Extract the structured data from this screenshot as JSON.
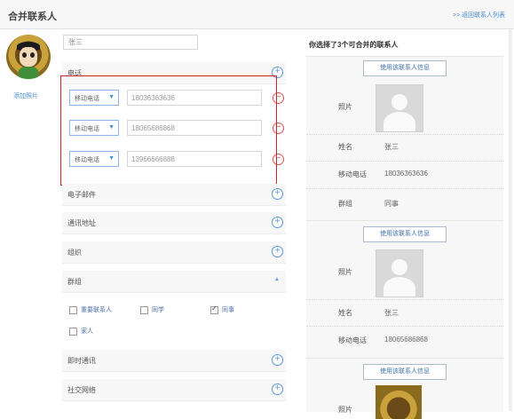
{
  "header": {
    "title": "合并联系人",
    "back_link": ">> 返回联系人列表"
  },
  "left": {
    "add_photo": "添加照片",
    "name_value": "张三",
    "sections": {
      "phone": "电话",
      "email": "电子邮件",
      "address": "通讯地址",
      "org": "组织",
      "group": "群组",
      "im": "即时通讯",
      "social": "社交网络"
    },
    "phones": [
      {
        "type": "移动电话",
        "number": "18036363636"
      },
      {
        "type": "移动电话",
        "number": "18065686868"
      },
      {
        "type": "移动电话",
        "number": "13966666888"
      }
    ],
    "groups": [
      {
        "label": "重要联系人",
        "checked": false
      },
      {
        "label": "同学",
        "checked": false
      },
      {
        "label": "同事",
        "checked": true
      },
      {
        "label": "家人",
        "checked": false
      }
    ]
  },
  "right": {
    "title": "你选择了3个可合并的联系人",
    "use_btn": "使用该联系人信息",
    "contacts": [
      {
        "photo_label": "照片",
        "name_label": "姓名",
        "name": "张三",
        "mobile_label": "移动电话",
        "mobile": "18036363636",
        "group_label": "群组",
        "group": "同事"
      },
      {
        "photo_label": "照片",
        "name_label": "姓名",
        "name": "张三",
        "mobile_label": "移动电话",
        "mobile": "18065686868"
      },
      {
        "photo_label": "照片"
      }
    ]
  },
  "icons": {
    "plus": "plus-circle-icon",
    "minus": "minus-circle-icon",
    "caret": "caret-up-icon",
    "dropdown": "chevron-down-icon"
  },
  "colors": {
    "accent": "#4a8ed1",
    "highlight_border": "#c9252b",
    "remove": "#d9534f"
  }
}
